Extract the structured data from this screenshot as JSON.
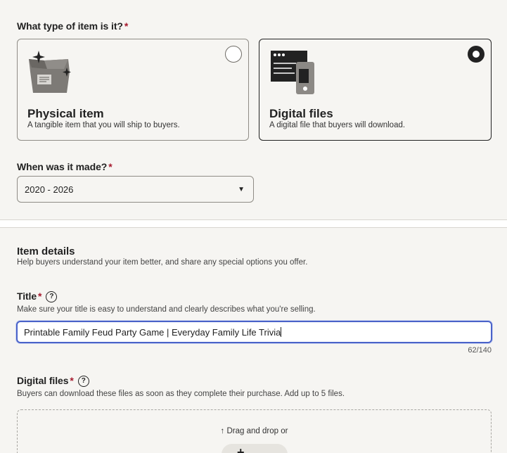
{
  "item_type": {
    "label": "What type of item is it?",
    "required_mark": "*",
    "options": [
      {
        "title": "Physical item",
        "description": "A tangible item that you will ship to buyers.",
        "selected": false,
        "icon": "box-icon"
      },
      {
        "title": "Digital files",
        "description": "A digital file that buyers will download.",
        "selected": true,
        "icon": "digital-files-icon"
      }
    ]
  },
  "when_made": {
    "label": "When was it made?",
    "required_mark": "*",
    "value": "2020 - 2026"
  },
  "item_details": {
    "title": "Item details",
    "help": "Help buyers understand your item better, and share any special options you offer."
  },
  "title_field": {
    "label": "Title",
    "required_mark": "*",
    "help": "Make sure your title is easy to understand and clearly describes what you're selling.",
    "value": "Printable Family Feud Party Game | Everyday Family Life Trivia",
    "counter": "62/140"
  },
  "digital_files": {
    "label": "Digital files",
    "required_mark": "*",
    "help": "Buyers can download these files as soon as they complete their purchase. Add up to 5 files.",
    "drop_text": "Drag and drop or",
    "upload_plus": "+"
  },
  "colors": {
    "accent": "#4a63c9",
    "required": "#a61a2e",
    "text": "#222222"
  }
}
